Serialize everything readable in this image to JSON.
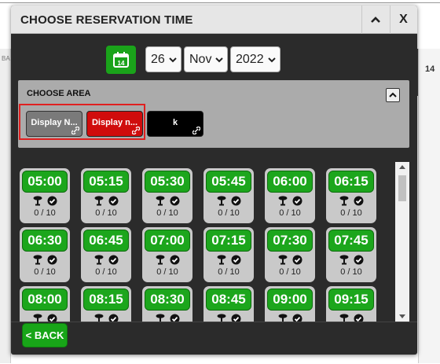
{
  "background": {
    "left_label": "BA",
    "right_label": "14"
  },
  "modal": {
    "title": "CHOOSE RESERVATION TIME",
    "collapse_label": "^",
    "close_label": "X"
  },
  "date": {
    "calendar_icon_day": "14",
    "day": "26",
    "month": "Nov",
    "year": "2022"
  },
  "area": {
    "title": "CHOOSE AREA",
    "collapse_label": "^",
    "buttons": [
      {
        "label": "Display N...",
        "color": "#7a7a7a"
      },
      {
        "label": "Display n...",
        "color": "#d00c0c"
      },
      {
        "label": "k",
        "color": "#000000"
      }
    ]
  },
  "slots": [
    {
      "time": "05:00",
      "count": "0 / 10"
    },
    {
      "time": "05:15",
      "count": "0 / 10"
    },
    {
      "time": "05:30",
      "count": "0 / 10"
    },
    {
      "time": "05:45",
      "count": "0 / 10"
    },
    {
      "time": "06:00",
      "count": "0 / 10"
    },
    {
      "time": "06:15",
      "count": "0 / 10"
    },
    {
      "time": "06:30",
      "count": "0 / 10"
    },
    {
      "time": "06:45",
      "count": "0 / 10"
    },
    {
      "time": "07:00",
      "count": "0 / 10"
    },
    {
      "time": "07:15",
      "count": "0 / 10"
    },
    {
      "time": "07:30",
      "count": "0 / 10"
    },
    {
      "time": "07:45",
      "count": "0 / 10"
    },
    {
      "time": "08:00",
      "count": ""
    },
    {
      "time": "08:15",
      "count": ""
    },
    {
      "time": "08:30",
      "count": ""
    },
    {
      "time": "08:45",
      "count": ""
    },
    {
      "time": "09:00",
      "count": ""
    },
    {
      "time": "09:15",
      "count": ""
    }
  ],
  "footer": {
    "back_label": "< BACK"
  },
  "colors": {
    "slot_green": "#1ca61c",
    "selected_outline": "#e02020"
  }
}
